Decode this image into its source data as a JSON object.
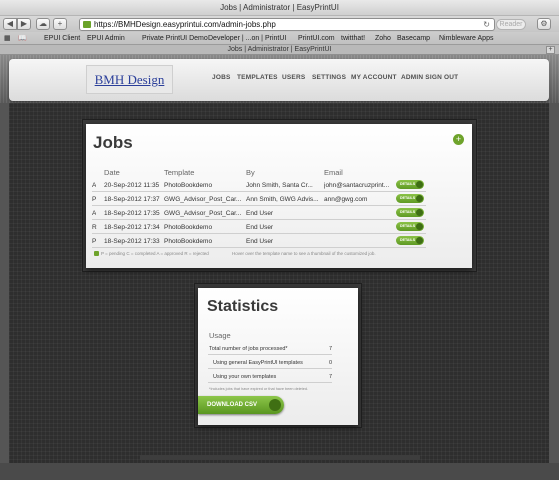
{
  "window": {
    "title": "Jobs | Administrator | EasyPrintUI"
  },
  "toolbar": {
    "url": "https://BMHDesign.easyprintui.com/admin-jobs.php",
    "reader_label": "Reader"
  },
  "bookmarks": [
    "EPUI Client",
    "EPUI Admin",
    "Private PrintUI Demo",
    "Developer | ...on | PrintUI",
    "PrintUI.com",
    "twitthat!",
    "Zoho",
    "Basecamp",
    "Nimbleware Apps"
  ],
  "tab": {
    "title": "Jobs | Administrator | EasyPrintUI"
  },
  "header": {
    "logo": "BMH Design",
    "nav": [
      "JOBS",
      "TEMPLATES",
      "USERS",
      "SETTINGS",
      "MY ACCOUNT",
      "ADMIN SIGN OUT"
    ]
  },
  "jobs": {
    "title": "Jobs",
    "columns": [
      "Date",
      "Template",
      "By",
      "Email"
    ],
    "rows": [
      {
        "status": "A",
        "date": "20-Sep-2012 11:35",
        "template": "PhotoBookdemo",
        "by": "John Smith, Santa Cr...",
        "email": "john@santacruzprint...",
        "action": "DETAILS"
      },
      {
        "status": "P",
        "date": "18-Sep-2012 17:37",
        "template": "GWG_Advisor_Post_Car...",
        "by": "Ann Smith, GWG Advis...",
        "email": "ann@gwg.com",
        "action": "DETAILS"
      },
      {
        "status": "A",
        "date": "18-Sep-2012 17:35",
        "template": "GWG_Advisor_Post_Car...",
        "by": "End User",
        "email": "",
        "action": "DETAILS"
      },
      {
        "status": "R",
        "date": "18-Sep-2012 17:34",
        "template": "PhotoBookdemo",
        "by": "End User",
        "email": "",
        "action": "DETAILS"
      },
      {
        "status": "P",
        "date": "18-Sep-2012 17:33",
        "template": "PhotoBookdemo",
        "by": "End User",
        "email": "",
        "action": "DETAILS"
      }
    ],
    "legend": "P = pending   C = completed   A = approved   R = rejected",
    "hover_note": "Hover over the template name to see a thumbnail of the customized job."
  },
  "statistics": {
    "title": "Statistics",
    "usage_label": "Usage",
    "rows": [
      {
        "label": "Total number of jobs processed*",
        "value": "7"
      },
      {
        "label": "Using general EasyPrintUI templates",
        "value": "0"
      },
      {
        "label": "Using your own templates",
        "value": "7"
      }
    ],
    "footnote": "*Includes jobs that have expired or that have been deleted.",
    "download_label": "DOWNLOAD CSV"
  },
  "colors": {
    "accent_green": "#6ea32b",
    "panel_bg": "#ffffff",
    "page_bg": "#2e2e2e"
  }
}
